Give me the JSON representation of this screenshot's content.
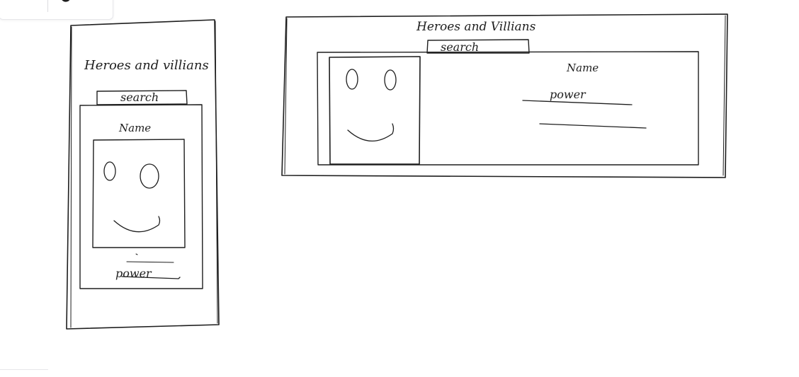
{
  "canvas": {
    "background": "#ffffff",
    "stroke_color": "#1e1e1e",
    "toolbar_icon": "moon-icon"
  },
  "mobile_wireframe": {
    "title": "Heroes and villians",
    "search_label": "search",
    "card_name": "Name",
    "card_power": "power",
    "avatar_icon": "smiley-face-icon"
  },
  "desktop_wireframe": {
    "title": "Heroes and Villians",
    "search_label": "search",
    "card_name": "Name",
    "card_power": "power",
    "avatar_icon": "smiley-face-icon"
  }
}
